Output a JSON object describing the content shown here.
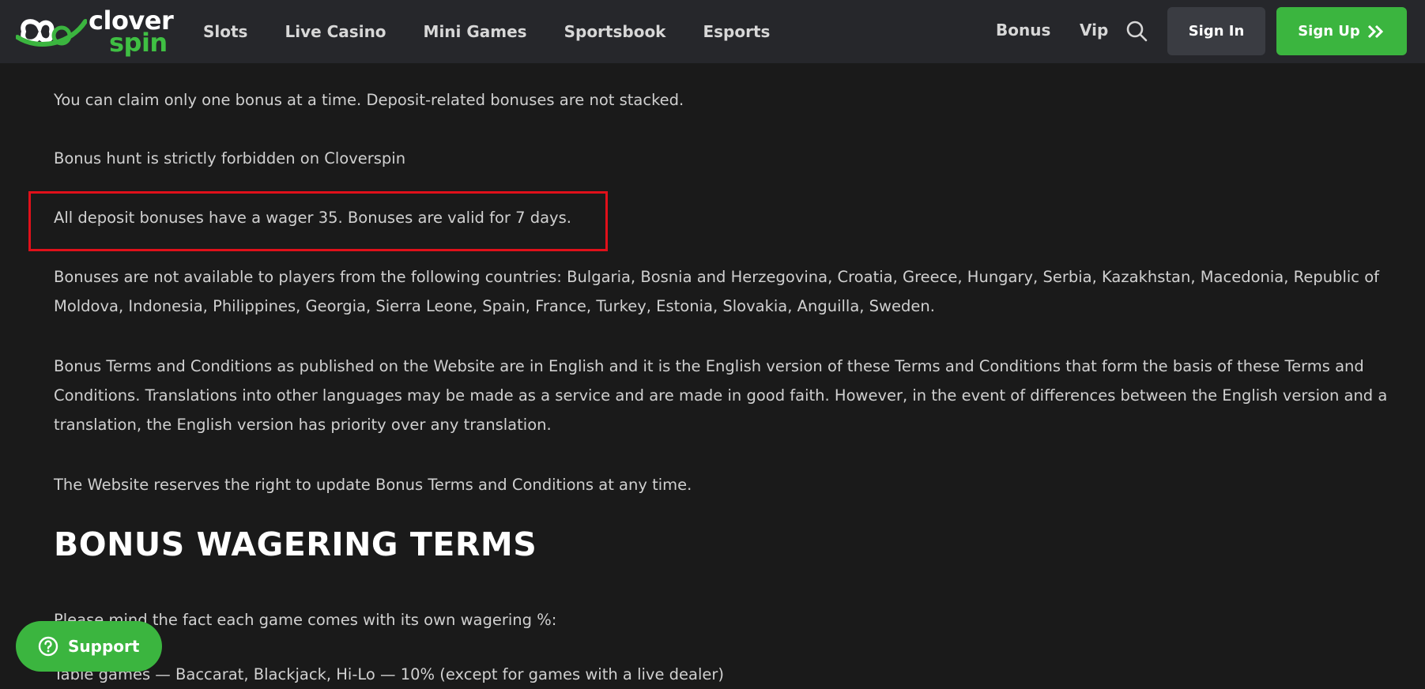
{
  "brand": {
    "line1": "clover",
    "line2": "spin",
    "accent": "#3bb53f"
  },
  "nav": {
    "items": [
      "Slots",
      "Live Casino",
      "Mini Games",
      "Sportsbook",
      "Esports"
    ],
    "bonus": "Bonus",
    "vip": "Vip",
    "search_icon": "search-icon",
    "sign_in": "Sign In",
    "sign_up": "Sign Up"
  },
  "content": {
    "p1": "You can claim only one bonus at a time. Deposit-related bonuses are not stacked.",
    "p2": "Bonus hunt is strictly forbidden on Cloverspin",
    "p3": "All deposit bonuses have a wager 35. Bonuses are valid for 7 days.",
    "p4": "Bonuses are not available to players from the following countries: Bulgaria, Bosnia and Herzegovina, Croatia, Greece, Hungary, Serbia, Kazakhstan, Macedonia, Republic of Moldova, Indonesia, Philippines, Georgia, Sierra Leone, Spain, France, Turkey, Estonia, Slovakia, Anguilla, Sweden.",
    "p5": "Bonus Terms and Conditions as published on the Website are in English and it is the English version of these Terms and Conditions that form the basis of these Terms and Conditions. Translations into other languages may be made as a service and are made in good faith. However, in the event of differences between the English version and a translation, the English version has priority over any translation.",
    "p6": "The Website reserves the right to update Bonus Terms and Conditions at any time.",
    "heading": "BONUS WAGERING TERMS",
    "p7": "Please mind the fact each game comes with its own wagering %:",
    "p8": "Table games — Baccarat, Blackjack, Hi-Lo — 10% (except for games with a live dealer)"
  },
  "highlight_color": "#e0101a",
  "support": {
    "label": "Support",
    "icon": "help-circle-icon"
  }
}
